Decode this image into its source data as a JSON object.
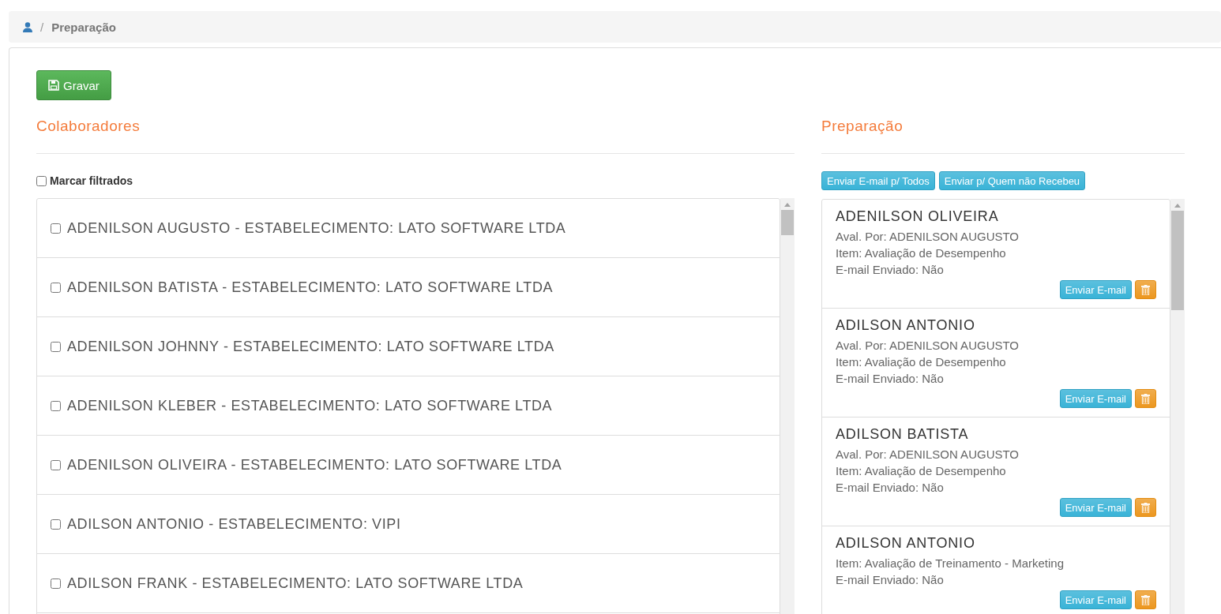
{
  "breadcrumb": {
    "separator": "/",
    "current": "Preparação"
  },
  "save_button": "Gravar",
  "collaborators": {
    "title": "Colaboradores",
    "mark_filtered": {
      "label": "Marcar filtrados",
      "checked": false
    },
    "items": [
      {
        "label": "ADENILSON AUGUSTO - ESTABELECIMENTO: LATO SOFTWARE LTDA",
        "checked": false
      },
      {
        "label": "ADENILSON BATISTA - ESTABELECIMENTO: LATO SOFTWARE LTDA",
        "checked": false
      },
      {
        "label": "ADENILSON JOHNNY - ESTABELECIMENTO: LATO SOFTWARE LTDA",
        "checked": false
      },
      {
        "label": "ADENILSON KLEBER - ESTABELECIMENTO: LATO SOFTWARE LTDA",
        "checked": false
      },
      {
        "label": "ADENILSON OLIVEIRA - ESTABELECIMENTO: LATO SOFTWARE LTDA",
        "checked": false
      },
      {
        "label": "ADILSON ANTONIO - ESTABELECIMENTO: VIPI",
        "checked": false
      },
      {
        "label": "ADILSON FRANK - ESTABELECIMENTO: LATO SOFTWARE LTDA",
        "checked": false
      }
    ]
  },
  "preparation": {
    "title": "Preparação",
    "actions": [
      "Enviar E-mail p/ Todos",
      "Enviar p/ Quem não Recebeu"
    ],
    "cards": [
      {
        "name": "ADENILSON OLIVEIRA",
        "lines": [
          "Aval. Por: ADENILSON AUGUSTO",
          "Item: Avaliação de Desempenho",
          "E-mail Enviado: Não"
        ],
        "send_button": "Enviar E-mail"
      },
      {
        "name": "ADILSON ANTONIO",
        "lines": [
          "Aval. Por: ADENILSON AUGUSTO",
          "Item: Avaliação de Desempenho",
          "E-mail Enviado: Não"
        ],
        "send_button": "Enviar E-mail"
      },
      {
        "name": "ADILSON BATISTA",
        "lines": [
          "Aval. Por: ADENILSON AUGUSTO",
          "Item: Avaliação de Desempenho",
          "E-mail Enviado: Não"
        ],
        "send_button": "Enviar E-mail"
      },
      {
        "name": "ADILSON ANTONIO",
        "lines": [
          "Item: Avaliação de Treinamento - Marketing",
          "E-mail Enviado: Não"
        ],
        "send_button": "Enviar E-mail"
      }
    ]
  }
}
